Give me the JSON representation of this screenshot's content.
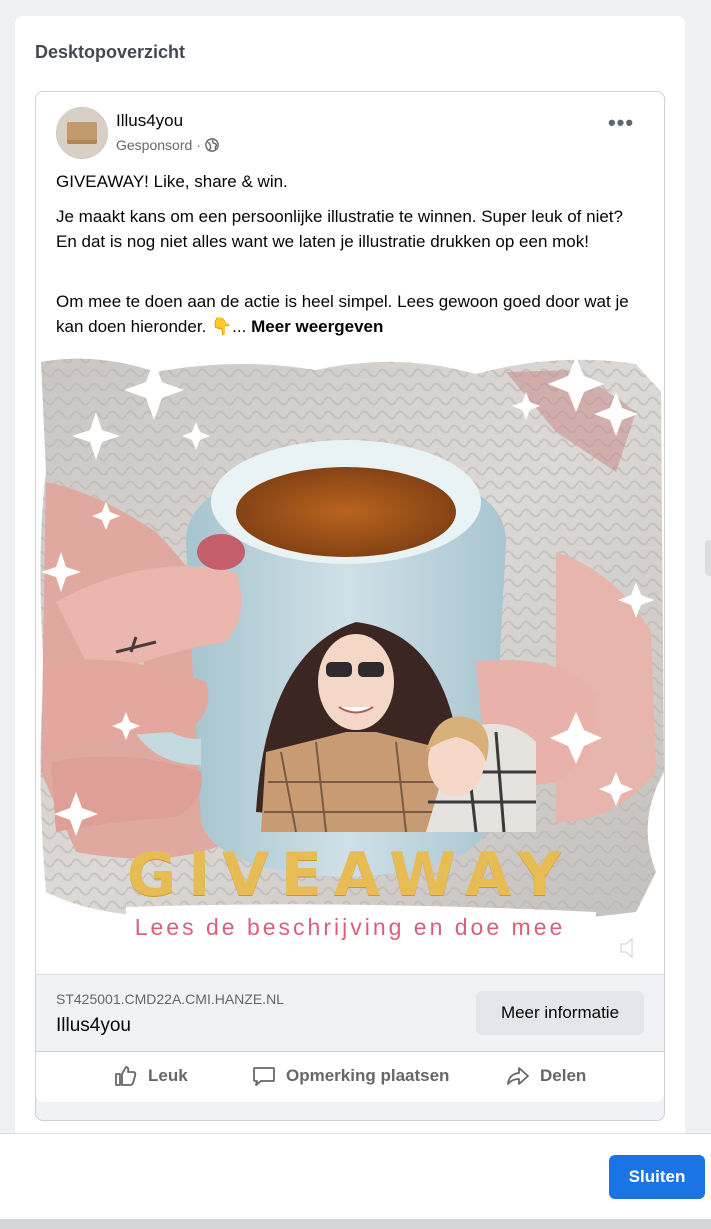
{
  "panel": {
    "title": "Desktopoverzicht"
  },
  "post": {
    "page_name": "Illus4you",
    "sponsored_label": "Gesponsord",
    "sponsored_separator": "·",
    "more_icon": "more-horizontal-icon",
    "lines": [
      "GIVEAWAY! Like, share & win.",
      "Je maakt kans om een persoonlijke illustratie te winnen. Super leuk of niet? En dat is nog niet alles want we laten je illustratie drukken op een mok!",
      "Om mee te doen aan de actie is heel simpel. Lees gewoon goed door wat je kan doen hieronder. 👇..."
    ],
    "see_more": "Meer weergeven",
    "media": {
      "headline": "GIVEAWAY",
      "subline": "Lees de beschrijving en doe mee",
      "mute_icon": "muted-speaker-icon"
    },
    "link": {
      "domain": "ST425001.CMD22A.CMI.HANZE.NL",
      "title": "Illus4you",
      "cta": "Meer informatie"
    },
    "actions": {
      "like": "Leuk",
      "comment": "Opmerking plaatsen",
      "share": "Delen"
    }
  },
  "footer": {
    "close_label": "Sluiten"
  },
  "colors": {
    "accent": "#1b74e4",
    "headline_gold": "#e8bc55",
    "subline_pink": "#d9607a"
  }
}
